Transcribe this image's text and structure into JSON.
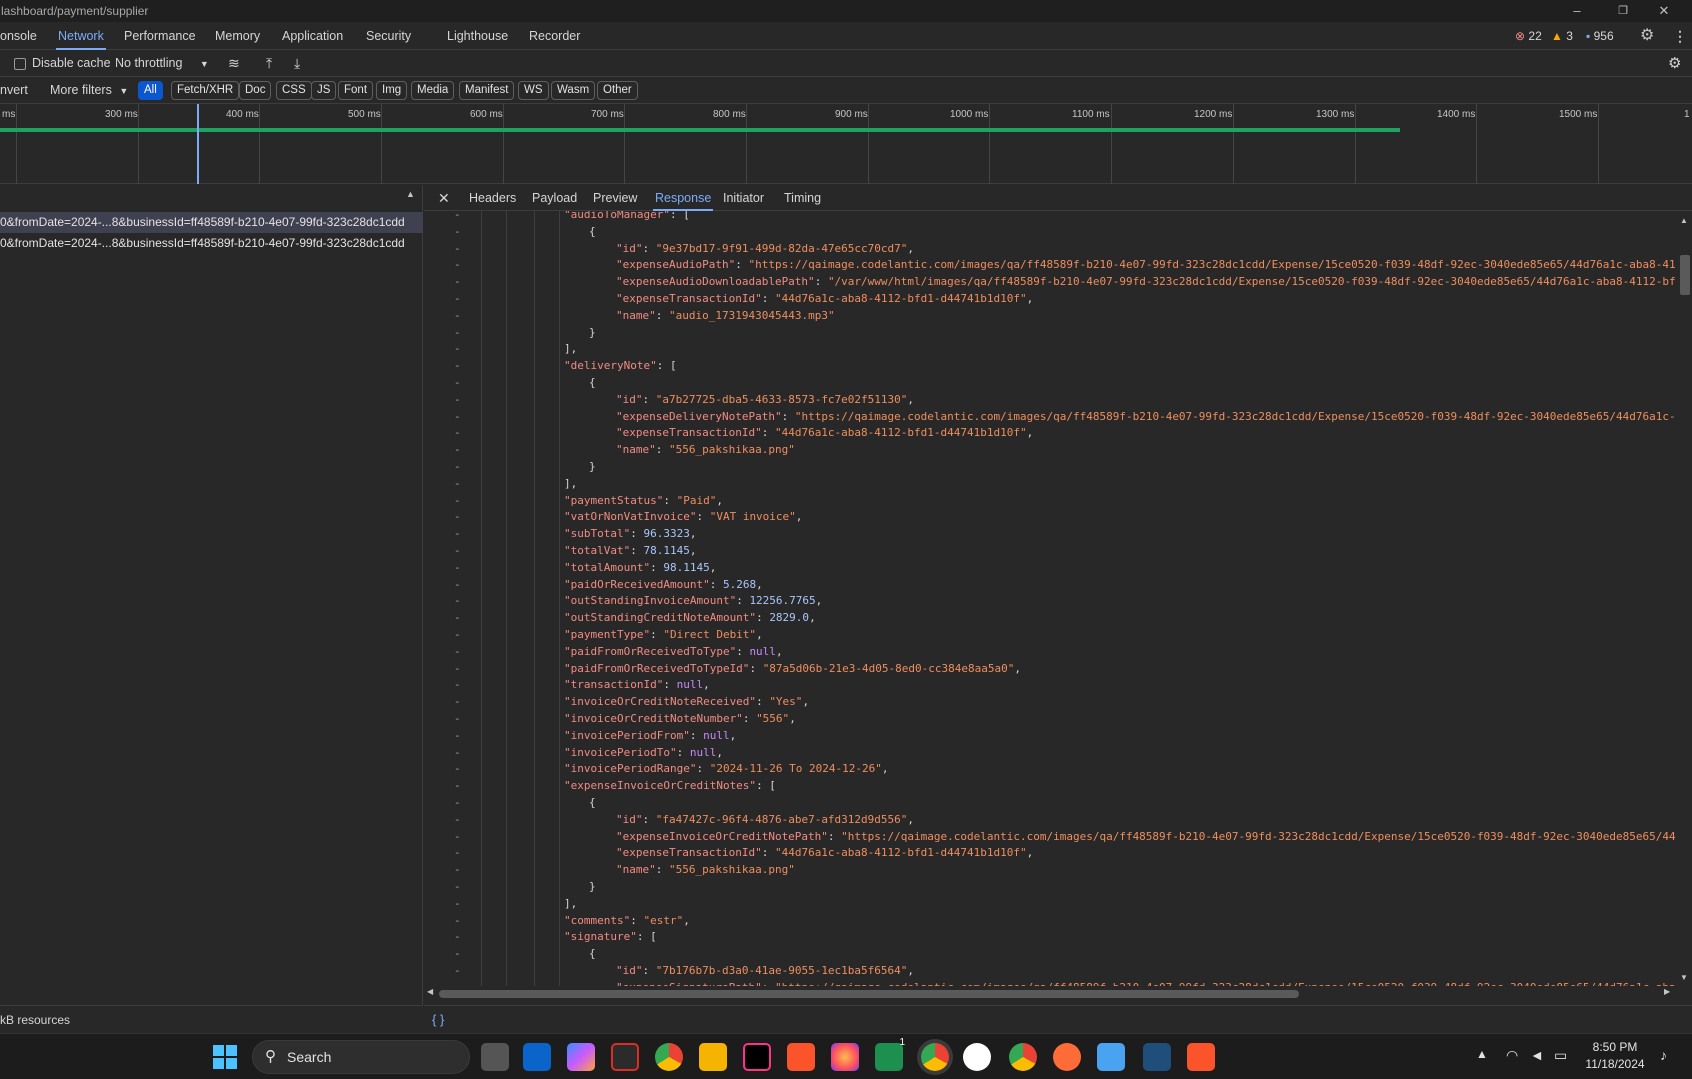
{
  "titlebar": {
    "url": "lashboard/payment/supplier",
    "minimize": "–",
    "restore": "❐",
    "close": "✕"
  },
  "main_tabs": [
    "onsole",
    "Network",
    "Performance",
    "Memory",
    "Application",
    "Security",
    "Lighthouse",
    "Recorder"
  ],
  "issues": {
    "errors": "22",
    "warnings": "3",
    "messages": "956"
  },
  "toolbar": {
    "disable_cache": "Disable cache",
    "throttling": "No throttling"
  },
  "filters": {
    "invert": "nvert",
    "more_filters": "More filters",
    "types": [
      "All",
      "Fetch/XHR",
      "Doc",
      "CSS",
      "JS",
      "Font",
      "Img",
      "Media",
      "Manifest",
      "WS",
      "Wasm",
      "Other"
    ]
  },
  "timeline_ticks": [
    "ms",
    "300 ms",
    "400 ms",
    "500 ms",
    "600 ms",
    "700 ms",
    "800 ms",
    "900 ms",
    "1000 ms",
    "1100 ms",
    "1200 ms",
    "1300 ms",
    "1400 ms",
    "1500 ms",
    "1"
  ],
  "requests": [
    "0&fromDate=2024-...8&businessId=ff48589f-b210-4e07-99fd-323c28dc1cdd",
    "0&fromDate=2024-...8&businessId=ff48589f-b210-4e07-99fd-323c28dc1cdd"
  ],
  "status_text": "kB resources",
  "detail_tabs": [
    "Headers",
    "Payload",
    "Preview",
    "Response",
    "Initiator",
    "Timing"
  ],
  "response_lines": [
    {
      "indent": 0,
      "parts": [
        {
          "t": "k",
          "v": "\"audioToManager\""
        },
        {
          "t": "p",
          "v": ": ["
        }
      ]
    },
    {
      "indent": 1,
      "parts": [
        {
          "t": "p",
          "v": "{"
        }
      ]
    },
    {
      "indent": 2,
      "parts": [
        {
          "t": "k",
          "v": "\"id\""
        },
        {
          "t": "p",
          "v": ": "
        },
        {
          "t": "s",
          "v": "\"9e37bd17-9f91-499d-82da-47e65cc70cd7\""
        },
        {
          "t": "p",
          "v": ","
        }
      ]
    },
    {
      "indent": 2,
      "parts": [
        {
          "t": "k",
          "v": "\"expenseAudioPath\""
        },
        {
          "t": "p",
          "v": ": "
        },
        {
          "t": "s",
          "v": "\"https://qaimage.codelantic.com/images/qa/ff48589f-b210-4e07-99fd-323c28dc1cdd/Expense/15ce0520-f039-48df-92ec-3040ede85e65/44d76a1c-aba8-411"
        }
      ]
    },
    {
      "indent": 2,
      "parts": [
        {
          "t": "k",
          "v": "\"expenseAudioDownloadablePath\""
        },
        {
          "t": "p",
          "v": ": "
        },
        {
          "t": "s",
          "v": "\"/var/www/html/images/qa/ff48589f-b210-4e07-99fd-323c28dc1cdd/Expense/15ce0520-f039-48df-92ec-3040ede85e65/44d76a1c-aba8-4112-bfd"
        }
      ]
    },
    {
      "indent": 2,
      "parts": [
        {
          "t": "k",
          "v": "\"expenseTransactionId\""
        },
        {
          "t": "p",
          "v": ": "
        },
        {
          "t": "s",
          "v": "\"44d76a1c-aba8-4112-bfd1-d44741b1d10f\""
        },
        {
          "t": "p",
          "v": ","
        }
      ]
    },
    {
      "indent": 2,
      "parts": [
        {
          "t": "k",
          "v": "\"name\""
        },
        {
          "t": "p",
          "v": ": "
        },
        {
          "t": "s",
          "v": "\"audio_1731943045443.mp3\""
        }
      ]
    },
    {
      "indent": 1,
      "parts": [
        {
          "t": "p",
          "v": "}"
        }
      ]
    },
    {
      "indent": 0,
      "parts": [
        {
          "t": "p",
          "v": "],"
        }
      ]
    },
    {
      "indent": 0,
      "parts": [
        {
          "t": "k",
          "v": "\"deliveryNote\""
        },
        {
          "t": "p",
          "v": ": ["
        }
      ]
    },
    {
      "indent": 1,
      "parts": [
        {
          "t": "p",
          "v": "{"
        }
      ]
    },
    {
      "indent": 2,
      "parts": [
        {
          "t": "k",
          "v": "\"id\""
        },
        {
          "t": "p",
          "v": ": "
        },
        {
          "t": "s",
          "v": "\"a7b27725-dba5-4633-8573-fc7e02f51130\""
        },
        {
          "t": "p",
          "v": ","
        }
      ]
    },
    {
      "indent": 2,
      "parts": [
        {
          "t": "k",
          "v": "\"expenseDeliveryNotePath\""
        },
        {
          "t": "p",
          "v": ": "
        },
        {
          "t": "s",
          "v": "\"https://qaimage.codelantic.com/images/qa/ff48589f-b210-4e07-99fd-323c28dc1cdd/Expense/15ce0520-f039-48df-92ec-3040ede85e65/44d76a1c-a"
        }
      ]
    },
    {
      "indent": 2,
      "parts": [
        {
          "t": "k",
          "v": "\"expenseTransactionId\""
        },
        {
          "t": "p",
          "v": ": "
        },
        {
          "t": "s",
          "v": "\"44d76a1c-aba8-4112-bfd1-d44741b1d10f\""
        },
        {
          "t": "p",
          "v": ","
        }
      ]
    },
    {
      "indent": 2,
      "parts": [
        {
          "t": "k",
          "v": "\"name\""
        },
        {
          "t": "p",
          "v": ": "
        },
        {
          "t": "s",
          "v": "\"556_pakshikaa.png\""
        }
      ]
    },
    {
      "indent": 1,
      "parts": [
        {
          "t": "p",
          "v": "}"
        }
      ]
    },
    {
      "indent": 0,
      "parts": [
        {
          "t": "p",
          "v": "],"
        }
      ]
    },
    {
      "indent": 0,
      "parts": [
        {
          "t": "k",
          "v": "\"paymentStatus\""
        },
        {
          "t": "p",
          "v": ": "
        },
        {
          "t": "s",
          "v": "\"Paid\""
        },
        {
          "t": "p",
          "v": ","
        }
      ]
    },
    {
      "indent": 0,
      "parts": [
        {
          "t": "k",
          "v": "\"vatOrNonVatInvoice\""
        },
        {
          "t": "p",
          "v": ": "
        },
        {
          "t": "s",
          "v": "\"VAT invoice\""
        },
        {
          "t": "p",
          "v": ","
        }
      ]
    },
    {
      "indent": 0,
      "parts": [
        {
          "t": "k",
          "v": "\"subTotal\""
        },
        {
          "t": "p",
          "v": ": "
        },
        {
          "t": "n",
          "v": "96.3323"
        },
        {
          "t": "p",
          "v": ","
        }
      ]
    },
    {
      "indent": 0,
      "parts": [
        {
          "t": "k",
          "v": "\"totalVat\""
        },
        {
          "t": "p",
          "v": ": "
        },
        {
          "t": "n",
          "v": "78.1145"
        },
        {
          "t": "p",
          "v": ","
        }
      ]
    },
    {
      "indent": 0,
      "parts": [
        {
          "t": "k",
          "v": "\"totalAmount\""
        },
        {
          "t": "p",
          "v": ": "
        },
        {
          "t": "n",
          "v": "98.1145"
        },
        {
          "t": "p",
          "v": ","
        }
      ]
    },
    {
      "indent": 0,
      "parts": [
        {
          "t": "k",
          "v": "\"paidOrReceivedAmount\""
        },
        {
          "t": "p",
          "v": ": "
        },
        {
          "t": "n",
          "v": "5.268"
        },
        {
          "t": "p",
          "v": ","
        }
      ]
    },
    {
      "indent": 0,
      "parts": [
        {
          "t": "k",
          "v": "\"outStandingInvoiceAmount\""
        },
        {
          "t": "p",
          "v": ": "
        },
        {
          "t": "n",
          "v": "12256.7765"
        },
        {
          "t": "p",
          "v": ","
        }
      ]
    },
    {
      "indent": 0,
      "parts": [
        {
          "t": "k",
          "v": "\"outStandingCreditNoteAmount\""
        },
        {
          "t": "p",
          "v": ": "
        },
        {
          "t": "n",
          "v": "2829.0"
        },
        {
          "t": "p",
          "v": ","
        }
      ]
    },
    {
      "indent": 0,
      "parts": [
        {
          "t": "k",
          "v": "\"paymentType\""
        },
        {
          "t": "p",
          "v": ": "
        },
        {
          "t": "s",
          "v": "\"Direct Debit\""
        },
        {
          "t": "p",
          "v": ","
        }
      ]
    },
    {
      "indent": 0,
      "parts": [
        {
          "t": "k",
          "v": "\"paidFromOrReceivedToType\""
        },
        {
          "t": "p",
          "v": ": "
        },
        {
          "t": "nl",
          "v": "null"
        },
        {
          "t": "p",
          "v": ","
        }
      ]
    },
    {
      "indent": 0,
      "parts": [
        {
          "t": "k",
          "v": "\"paidFromOrReceivedToTypeId\""
        },
        {
          "t": "p",
          "v": ": "
        },
        {
          "t": "s",
          "v": "\"87a5d06b-21e3-4d05-8ed0-cc384e8aa5a0\""
        },
        {
          "t": "p",
          "v": ","
        }
      ]
    },
    {
      "indent": 0,
      "parts": [
        {
          "t": "k",
          "v": "\"transactionId\""
        },
        {
          "t": "p",
          "v": ": "
        },
        {
          "t": "nl",
          "v": "null"
        },
        {
          "t": "p",
          "v": ","
        }
      ]
    },
    {
      "indent": 0,
      "parts": [
        {
          "t": "k",
          "v": "\"invoiceOrCreditNoteReceived\""
        },
        {
          "t": "p",
          "v": ": "
        },
        {
          "t": "s",
          "v": "\"Yes\""
        },
        {
          "t": "p",
          "v": ","
        }
      ]
    },
    {
      "indent": 0,
      "parts": [
        {
          "t": "k",
          "v": "\"invoiceOrCreditNoteNumber\""
        },
        {
          "t": "p",
          "v": ": "
        },
        {
          "t": "s",
          "v": "\"556\""
        },
        {
          "t": "p",
          "v": ","
        }
      ]
    },
    {
      "indent": 0,
      "parts": [
        {
          "t": "k",
          "v": "\"invoicePeriodFrom\""
        },
        {
          "t": "p",
          "v": ": "
        },
        {
          "t": "nl",
          "v": "null"
        },
        {
          "t": "p",
          "v": ","
        }
      ]
    },
    {
      "indent": 0,
      "parts": [
        {
          "t": "k",
          "v": "\"invoicePeriodTo\""
        },
        {
          "t": "p",
          "v": ": "
        },
        {
          "t": "nl",
          "v": "null"
        },
        {
          "t": "p",
          "v": ","
        }
      ]
    },
    {
      "indent": 0,
      "parts": [
        {
          "t": "k",
          "v": "\"invoicePeriodRange\""
        },
        {
          "t": "p",
          "v": ": "
        },
        {
          "t": "s",
          "v": "\"2024-11-26 To 2024-12-26\""
        },
        {
          "t": "p",
          "v": ","
        }
      ]
    },
    {
      "indent": 0,
      "parts": [
        {
          "t": "k",
          "v": "\"expenseInvoiceOrCreditNotes\""
        },
        {
          "t": "p",
          "v": ": ["
        }
      ]
    },
    {
      "indent": 1,
      "parts": [
        {
          "t": "p",
          "v": "{"
        }
      ]
    },
    {
      "indent": 2,
      "parts": [
        {
          "t": "k",
          "v": "\"id\""
        },
        {
          "t": "p",
          "v": ": "
        },
        {
          "t": "s",
          "v": "\"fa47427c-96f4-4876-abe7-afd312d9d556\""
        },
        {
          "t": "p",
          "v": ","
        }
      ]
    },
    {
      "indent": 2,
      "parts": [
        {
          "t": "k",
          "v": "\"expenseInvoiceOrCreditNotePath\""
        },
        {
          "t": "p",
          "v": ": "
        },
        {
          "t": "s",
          "v": "\"https://qaimage.codelantic.com/images/qa/ff48589f-b210-4e07-99fd-323c28dc1cdd/Expense/15ce0520-f039-48df-92ec-3040ede85e65/44c"
        }
      ]
    },
    {
      "indent": 2,
      "parts": [
        {
          "t": "k",
          "v": "\"expenseTransactionId\""
        },
        {
          "t": "p",
          "v": ": "
        },
        {
          "t": "s",
          "v": "\"44d76a1c-aba8-4112-bfd1-d44741b1d10f\""
        },
        {
          "t": "p",
          "v": ","
        }
      ]
    },
    {
      "indent": 2,
      "parts": [
        {
          "t": "k",
          "v": "\"name\""
        },
        {
          "t": "p",
          "v": ": "
        },
        {
          "t": "s",
          "v": "\"556_pakshikaa.png\""
        }
      ]
    },
    {
      "indent": 1,
      "parts": [
        {
          "t": "p",
          "v": "}"
        }
      ]
    },
    {
      "indent": 0,
      "parts": [
        {
          "t": "p",
          "v": "],"
        }
      ]
    },
    {
      "indent": 0,
      "parts": [
        {
          "t": "k",
          "v": "\"comments\""
        },
        {
          "t": "p",
          "v": ": "
        },
        {
          "t": "s",
          "v": "\"estr\""
        },
        {
          "t": "p",
          "v": ","
        }
      ]
    },
    {
      "indent": 0,
      "parts": [
        {
          "t": "k",
          "v": "\"signature\""
        },
        {
          "t": "p",
          "v": ": ["
        }
      ]
    },
    {
      "indent": 1,
      "parts": [
        {
          "t": "p",
          "v": "{"
        }
      ]
    },
    {
      "indent": 2,
      "parts": [
        {
          "t": "k",
          "v": "\"id\""
        },
        {
          "t": "p",
          "v": ": "
        },
        {
          "t": "s",
          "v": "\"7b176b7b-d3a0-41ae-9055-1ec1ba5f6564\""
        },
        {
          "t": "p",
          "v": ","
        }
      ]
    },
    {
      "indent": 2,
      "parts": [
        {
          "t": "k",
          "v": "\"expenseSignaturePath\""
        },
        {
          "t": "p",
          "v": ": "
        },
        {
          "t": "s",
          "v": "\"https://qaimage.codelantic.com/images/qa/ff48589f-b210-4e07-99fd-323c28dc1cdd/Expense/15ce0520-f039-48df-92ec-3040ede85e65/44d76a1c-aba"
        }
      ]
    }
  ],
  "bottom_bar": {
    "pretty_print": "{ }"
  },
  "taskbar": {
    "search_placeholder": "Search",
    "time": "8:50 PM",
    "date": "11/18/2024",
    "badge": "1"
  },
  "colors": {
    "accent": "#7cacf8",
    "key": "#f28b82",
    "string": "#ee8e5f",
    "number": "#a8c7fa",
    "null": "#c58af9",
    "error": "#f28b82",
    "warning": "#f9ab00"
  }
}
